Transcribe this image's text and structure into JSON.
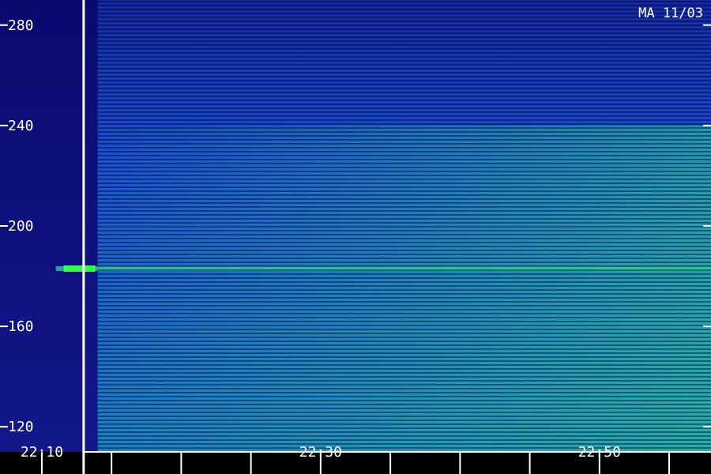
{
  "station_label": "MA 11/03",
  "colors": {
    "background": "#000000",
    "low": "#0a0a6e",
    "mid": "#1a4fd8",
    "high": "#2fd39a",
    "peak": "#33ff44",
    "axis": "#ffffff"
  },
  "chart_data": {
    "type": "heatmap",
    "title": "",
    "xlabel": "",
    "ylabel": "",
    "x_tick_labels": [
      "22:10",
      "22:30",
      "22:50"
    ],
    "y_tick_labels": [
      "120",
      "160",
      "200",
      "240",
      "280"
    ],
    "y_ticks": [
      120,
      160,
      200,
      240,
      280
    ],
    "ylim": [
      110,
      290
    ],
    "xlim": [
      "22:07",
      "22:58"
    ],
    "x_labeled_ticks": [
      "22:10",
      "22:30",
      "22:50"
    ],
    "grid": false,
    "event_start": "22:14",
    "marker_time": "22:13",
    "bright_band_center": 183,
    "bright_band_start": "22:11",
    "bright_band_end": "22:58",
    "intensity_regions": [
      {
        "from": "22:07",
        "to": "22:14",
        "level": "low"
      },
      {
        "from": "22:14",
        "to": "22:58",
        "level": "high"
      }
    ]
  }
}
